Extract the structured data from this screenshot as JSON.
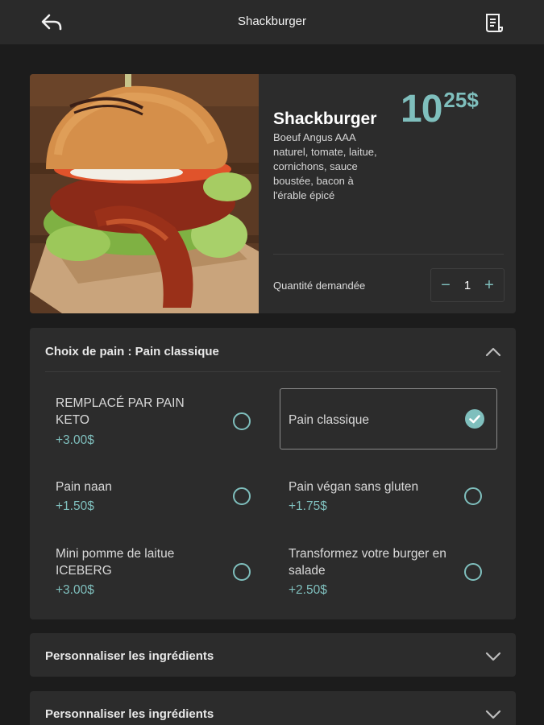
{
  "header": {
    "title": "Shackburger",
    "back_icon": "back-arrow-icon",
    "receipt_icon": "receipt-icon"
  },
  "product": {
    "name": "Shackburger",
    "description": " Boeuf Angus AAA naturel, tomate, laitue, cornichons, sauce boustée, bacon à l'érable épicé",
    "price_integer": "10",
    "price_cents": "25",
    "price_currency": "$",
    "quantity_label": "Quantité demandée",
    "quantity_value": "1",
    "minus_label": "−",
    "plus_label": "+"
  },
  "bread_choice": {
    "title": "Choix de pain : Pain classique",
    "options": [
      {
        "label": "REMPLACÉ PAR PAIN KETO",
        "price": "+3.00$",
        "selected": false
      },
      {
        "label": "Pain classique",
        "price": "",
        "selected": true
      },
      {
        "label": "Pain naan",
        "price": "+1.50$",
        "selected": false
      },
      {
        "label": "Pain végan sans gluten",
        "price": "+1.75$",
        "selected": false
      },
      {
        "label": "Mini pomme de laitue ICEBERG",
        "price": "+3.00$",
        "selected": false
      },
      {
        "label": "Transformez votre burger en salade",
        "price": "+2.50$",
        "selected": false
      }
    ]
  },
  "sections": [
    {
      "title": "Personnaliser les ingrédients"
    },
    {
      "title": "Personnaliser les ingrédients"
    }
  ],
  "colors": {
    "accent": "#7fbfbd",
    "background": "#1c1c1c",
    "panel": "#2c2c2c",
    "topbar": "#2a2a2a"
  }
}
